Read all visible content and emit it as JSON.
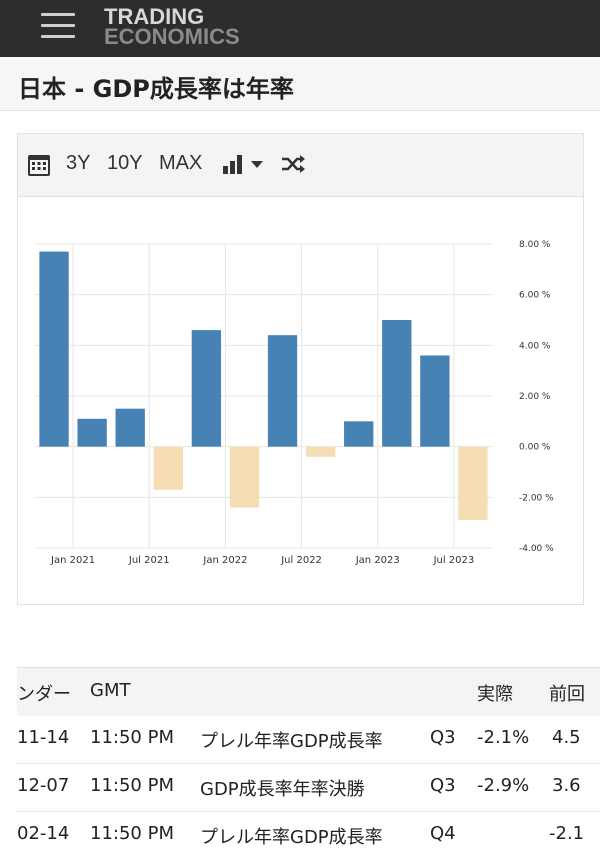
{
  "header": {
    "logo_line1": "TRADING",
    "logo_line2": "ECONOMICS"
  },
  "page_title": "日本 - GDP成長率は年率",
  "toolbar": {
    "range_3y": "3Y",
    "range_10y": "10Y",
    "range_max": "MAX"
  },
  "chart_data": {
    "type": "bar",
    "categories": [
      "Q4 2020",
      "Q1 2021",
      "Q2 2021",
      "Q3 2021",
      "Q4 2021",
      "Q1 2022",
      "Q2 2022",
      "Q3 2022",
      "Q4 2022",
      "Q1 2023",
      "Q2 2023",
      "Q3 2023"
    ],
    "values": [
      7.7,
      1.1,
      1.5,
      -1.7,
      4.6,
      -2.4,
      4.4,
      -0.4,
      1.0,
      5.0,
      3.6,
      -2.9
    ],
    "x_tick_labels": [
      "Jan 2021",
      "Jul 2021",
      "Jan 2022",
      "Jul 2022",
      "Jan 2023",
      "Jul 2023"
    ],
    "y_tick_labels": [
      "8.00 %",
      "6.00 %",
      "4.00 %",
      "2.00 %",
      "0.00 %",
      "-2.00 %",
      "-4.00 %"
    ],
    "ylim": [
      -4,
      8
    ],
    "grid": true,
    "colors": {
      "positive": "#4682b4",
      "negative": "#f5deb3"
    }
  },
  "table": {
    "headers": [
      "ンダー",
      "GMT",
      "",
      "",
      "実際",
      "前回"
    ],
    "rows": [
      [
        "11-14",
        "11:50 PM",
        "プレル年率GDP成長率",
        "Q3",
        "-2.1%",
        "4.5"
      ],
      [
        "12-07",
        "11:50 PM",
        "GDP成長率年率決勝",
        "Q3",
        "-2.9%",
        "3.6"
      ],
      [
        "02-14",
        "11:50 PM",
        "プレル年率GDP成長率",
        "Q4",
        "",
        "-2.1"
      ]
    ]
  }
}
